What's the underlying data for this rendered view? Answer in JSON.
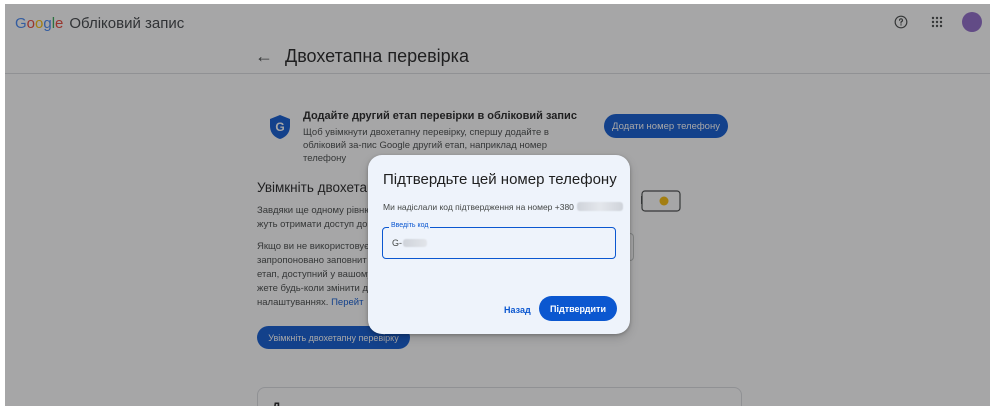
{
  "header": {
    "logo_text": "Google",
    "product_name": "Обліковий запис",
    "help_icon": "help-circle-icon",
    "apps_icon": "apps-grid-icon",
    "avatar_color": "#8e68c9"
  },
  "page": {
    "title": "Двохетапна перевірка"
  },
  "info": {
    "heading": "Додайте другий етап перевірки в обліковий запис",
    "text": "Щоб увімкнути двохетапну перевірку, спершу додайте в обліковий за-пис Google другий етап, наприклад номер телефону",
    "add_phone_label": "Додати номер телефону"
  },
  "section": {
    "heading": "Увімкніть двохетап",
    "para1": "Завдяки ще одному рівню жуть отримати доступ до",
    "para2_lines": "Якщо ви не використовує запропоновано заповнит етап, доступний у вашому жете будь-коли змінити д в налаштуваннях.",
    "para2_link": "Перейт",
    "enable_button": "Увімкніть двохетапну перевірку",
    "bottom_card_text": "Д"
  },
  "dialog": {
    "title": "Підтвердьте цей номер телефону",
    "description": "Ми надіслали код підтвердження на номер +380",
    "code_label": "Введіть код",
    "code_prefix": "G-",
    "back_label": "Назад",
    "confirm_label": "Підтвердити"
  },
  "colors": {
    "accent": "#0b57d0",
    "dialog_bg": "#eef3fb",
    "scrim": "rgba(32,33,36,0.40)"
  }
}
